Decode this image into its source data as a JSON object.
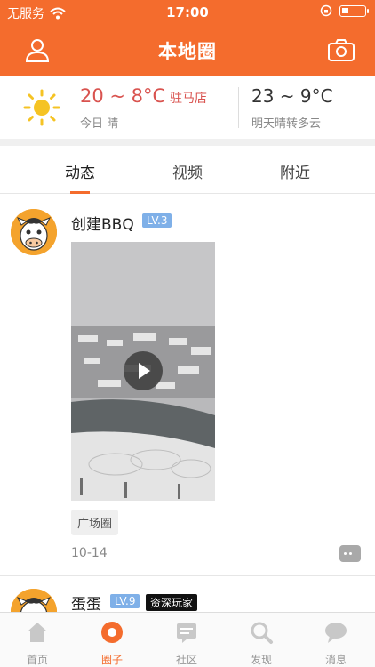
{
  "status_bar": {
    "carrier": "无服务",
    "time": "17:00"
  },
  "header": {
    "title": "本地圈"
  },
  "weather": {
    "today_temp": "20 ~ 8°C",
    "location": "驻马店",
    "today_desc": "今日 晴",
    "tomorrow_temp": "23 ~ 9°C",
    "tomorrow_desc": "明天晴转多云"
  },
  "tabs": [
    {
      "label": "动态"
    },
    {
      "label": "视频"
    },
    {
      "label": "附近"
    }
  ],
  "posts": [
    {
      "username": "创建BBQ",
      "level": "LV.3",
      "tag": "广场圈",
      "date": "10-14"
    },
    {
      "username": "蛋蛋",
      "level": "LV.9",
      "title_badge": "资深玩家"
    }
  ],
  "bottom_nav": [
    {
      "label": "首页"
    },
    {
      "label": "圈子"
    },
    {
      "label": "社区"
    },
    {
      "label": "发现"
    },
    {
      "label": "消息"
    }
  ],
  "colors": {
    "accent": "#f46c2d",
    "temp_today": "#d9534f",
    "level_badge": "#7fb0e8"
  },
  "battery_level": 0.3
}
